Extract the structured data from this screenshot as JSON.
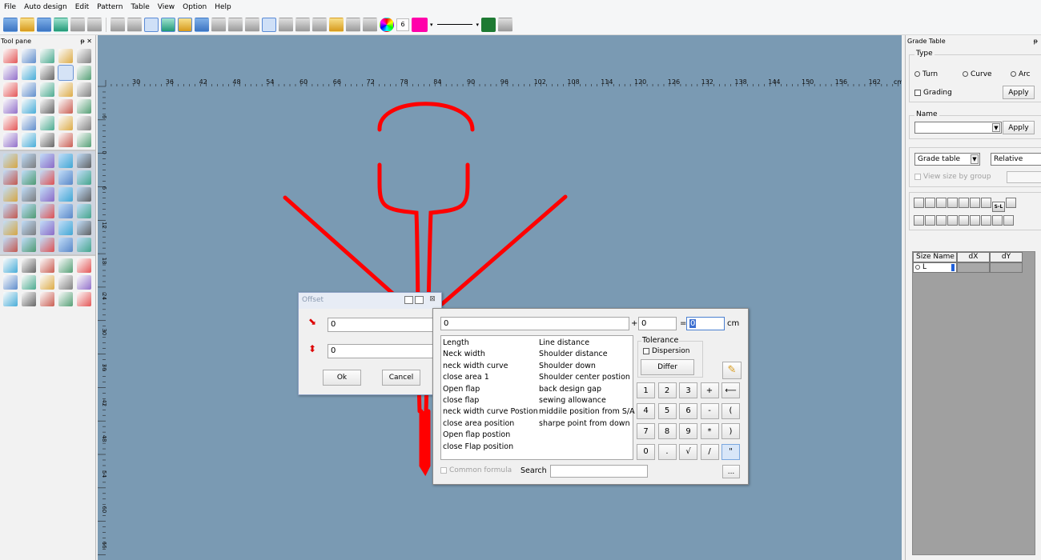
{
  "menu": [
    "File",
    "Auto design",
    "Edit",
    "Pattern",
    "Table",
    "View",
    "Option",
    "Help"
  ],
  "toolbar": {
    "pen_width": "6",
    "pen_color": "#ff00aa"
  },
  "tool_pane": {
    "title": "Tool pane",
    "pin": "ᵽ",
    "close": "✕"
  },
  "ruler": {
    "unit": "cm",
    "h_ticks": [
      "30",
      "36",
      "42",
      "48",
      "54",
      "60",
      "66",
      "72",
      "78",
      "84",
      "90",
      "96",
      "102",
      "108",
      "114",
      "120",
      "126",
      "132",
      "138",
      "144",
      "150",
      "156",
      "162"
    ],
    "v_ticks": [
      "6",
      "0",
      "6",
      "12",
      "18",
      "24",
      "30",
      "36",
      "42",
      "48",
      "54",
      "60",
      "66",
      "72"
    ]
  },
  "pattern_color": "#ff0000",
  "grade_table": {
    "title": "Grade Table",
    "type_label": "Type",
    "turn": "Turn",
    "curve": "Curve",
    "arc": "Arc",
    "grading": "Grading",
    "apply": "Apply",
    "name_label": "Name",
    "name_value": "",
    "apply2": "Apply",
    "table_select": "Grade table",
    "mode_select": "Relative",
    "view_by_group": "View size by group",
    "sizeletter": "S-L",
    "cols": [
      "Size Name",
      "dX",
      "dY"
    ],
    "rows": [
      {
        "size": "L",
        "dx": "",
        "dy": ""
      }
    ]
  },
  "offset_dialog": {
    "title": "Offset",
    "x_value": "0",
    "y_value": "0",
    "ok": "Ok",
    "cancel": "Cancel"
  },
  "calc": {
    "formula": "0",
    "plus": "+",
    "plus_value": "0",
    "equals": "=",
    "result": "0",
    "unit": "cm",
    "col1": [
      "Length",
      "Neck width",
      "neck width curve",
      "close area 1",
      "Open flap",
      "close flap",
      "neck width curve Postion",
      "close area position",
      "Open flap postion",
      "close Flap position"
    ],
    "col2": [
      "Line distance",
      "Shoulder distance",
      "Shoulder down",
      "Shoulder center postion",
      "back design gap",
      "sewing allowance",
      "middile position from S/A",
      "sharpe point from down"
    ],
    "tolerance": "Tolerance",
    "dispersion": "Dispersion",
    "differ": "Differ",
    "keys": [
      [
        "1",
        "2",
        "3",
        "+",
        "⟵"
      ],
      [
        "4",
        "5",
        "6",
        "-",
        "("
      ],
      [
        "7",
        "8",
        "9",
        "*",
        ")"
      ],
      [
        "0",
        ".",
        "√",
        "/",
        "\""
      ]
    ],
    "common_formula": "Common formula",
    "search": "Search",
    "search_value": "",
    "more": "..."
  }
}
